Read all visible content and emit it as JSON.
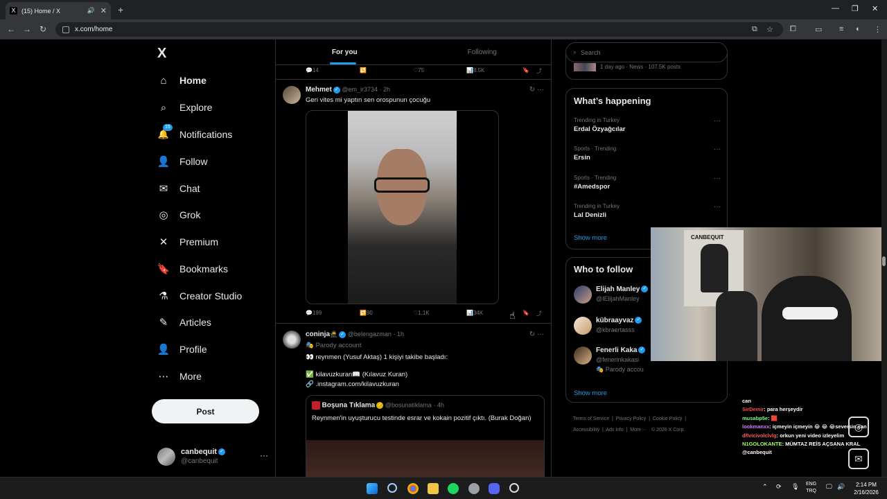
{
  "browser": {
    "tab_title": "(15) Home / X",
    "tab_favicon": "X",
    "url": "x.com/home",
    "new_tab": "+"
  },
  "nav": {
    "logo": "X",
    "items": [
      {
        "label": "Home",
        "icon": "home-icon",
        "glyph": "⌂"
      },
      {
        "label": "Explore",
        "icon": "search-icon",
        "glyph": "⌕"
      },
      {
        "label": "Notifications",
        "icon": "bell-icon",
        "glyph": "🔔"
      },
      {
        "label": "Follow",
        "icon": "add-person-icon",
        "glyph": "👤"
      },
      {
        "label": "Chat",
        "icon": "mail-icon",
        "glyph": "✉"
      },
      {
        "label": "Grok",
        "icon": "grok-icon",
        "glyph": "◎"
      },
      {
        "label": "Premium",
        "icon": "x-icon",
        "glyph": "✕"
      },
      {
        "label": "Bookmarks",
        "icon": "bookmark-icon",
        "glyph": "🔖"
      },
      {
        "label": "Creator Studio",
        "icon": "flask-icon",
        "glyph": "⚗"
      },
      {
        "label": "Articles",
        "icon": "article-icon",
        "glyph": "✎"
      },
      {
        "label": "Profile",
        "icon": "person-icon",
        "glyph": "👤"
      },
      {
        "label": "More",
        "icon": "more-circle-icon",
        "glyph": "⋯"
      }
    ],
    "notif_badge": "15",
    "post_label": "Post",
    "me_name": "canbequit",
    "me_handle": "@canbequit",
    "me_dots": "···"
  },
  "feed": {
    "tabs": [
      "For you",
      "Following"
    ],
    "top_actions": {
      "replies": "14",
      "likes": "75",
      "views": "8.5K"
    },
    "post1": {
      "name": "Mehmet",
      "handle": "@em_ir3734",
      "time": "· 2h",
      "text": "Geri vites mi yaptın sen orospunun çocuğu",
      "replies": "199",
      "reposts": "90",
      "likes": "1.1K",
      "views": "34K"
    },
    "post2": {
      "name": "coninja",
      "name_emoji": "🥷",
      "handle": "@belengazman",
      "time": "· 1h",
      "badge": "🎭 Parody account",
      "line1": "👀 reynmen (Yusuf Aktaş) 1 kişiyi takibe başladı:",
      "line2": "✅ kilavuzkuran📖 (Kılavuz Kuran)",
      "line3": "🔗 .instagram.com/kilavuzkuran",
      "quote_name": "Boşuna Tıklama",
      "quote_handle": "@bosunatiklama",
      "quote_time": "· 4h",
      "quote_text": "Reynmen'in uyuşturucu testinde esrar ve kokain pozitif çıktı. (Burak Doğan)"
    }
  },
  "right": {
    "search_placeholder": "Search",
    "top_meta": "1 day ago · News · 107.5K posts",
    "happening_title": "What’s happening",
    "trends": [
      {
        "meta": "Trending in Turkey",
        "name": "Erdal Özyağcılar"
      },
      {
        "meta": "Sports · Trending",
        "name": "Ersin"
      },
      {
        "meta": "Sports · Trending",
        "name": "#Amedspor"
      },
      {
        "meta": "Trending in Turkey",
        "name": "Lal Denizli"
      }
    ],
    "show_more": "Show more",
    "who_title": "Who to follow",
    "follows": [
      {
        "name": "Elijah Manley",
        "handle": "@IElijahManley"
      },
      {
        "name": "kübraayvaz",
        "handle": "@kbraertasss"
      },
      {
        "name": "Fenerli Kaka",
        "handle": "@fenerinkakasi",
        "extra": "🎭 Parody accou"
      }
    ],
    "footer": [
      "Terms of Service",
      "Privacy Policy",
      "Cookie Policy",
      "Accessibility",
      "Ads info",
      "More ···",
      "© 2026 X Corp."
    ]
  },
  "stream": {
    "poster_text": "CANBEQUIT",
    "chat": [
      {
        "user": "",
        "msg": "can"
      },
      {
        "user": "SirDemir",
        "msg": ": para herşeydir"
      },
      {
        "user": "musabp5e",
        "msg": ": 🟥"
      },
      {
        "user": "lookmanxx",
        "msg": ": içmeyin içmeyin 😂 😂 😂seversin can"
      },
      {
        "user": "dflvicivolclvlg",
        "msg": ": orkun yeni video izleyelim"
      },
      {
        "user": "N1GOLOKANTE",
        "msg": ": MÜMTAZ REİS AÇSANA KRAL @canbequit"
      }
    ]
  },
  "taskbar": {
    "lang_top": "ENG",
    "lang_bottom": "TRQ",
    "time": "2:14 PM",
    "date": "2/16/2026"
  }
}
